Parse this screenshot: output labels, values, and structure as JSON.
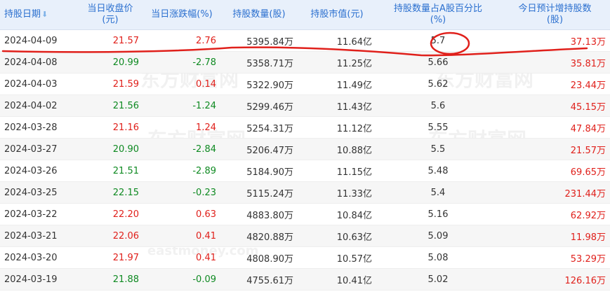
{
  "header": {
    "date": "持股日期",
    "close": "当日收盘价\n(元)",
    "change": "当日涨跌幅(%)",
    "qty": "持股数量(股)",
    "value": "持股市值(元)",
    "ratio": "持股数量占A股百分比\n(%)",
    "est": "今日预计增持股数\n(股)"
  },
  "icons": {
    "sort": "sort-down-arrow-icon"
  },
  "colors": {
    "up": "#e0201b",
    "down": "#0f8a22",
    "header_bg": "#e8f0fb",
    "header_text": "#2a6fcf",
    "annotation": "#e0201b"
  },
  "watermark": {
    "text": "东方财富网",
    "sub": "eastmoney.com"
  },
  "rows": [
    {
      "date": "2024-04-09",
      "close": "21.57",
      "change": "2.76",
      "qty": "5395.84万",
      "value": "11.64亿",
      "ratio": "5.7",
      "est": "37.13万",
      "dir": "up"
    },
    {
      "date": "2024-04-08",
      "close": "20.99",
      "change": "-2.78",
      "qty": "5358.71万",
      "value": "11.25亿",
      "ratio": "5.66",
      "est": "35.81万",
      "dir": "down"
    },
    {
      "date": "2024-04-03",
      "close": "21.59",
      "change": "0.14",
      "qty": "5322.90万",
      "value": "11.49亿",
      "ratio": "5.62",
      "est": "23.44万",
      "dir": "up"
    },
    {
      "date": "2024-04-02",
      "close": "21.56",
      "change": "-1.24",
      "qty": "5299.46万",
      "value": "11.43亿",
      "ratio": "5.6",
      "est": "45.15万",
      "dir": "down"
    },
    {
      "date": "2024-03-28",
      "close": "21.16",
      "change": "1.24",
      "qty": "5254.31万",
      "value": "11.12亿",
      "ratio": "5.55",
      "est": "47.84万",
      "dir": "up"
    },
    {
      "date": "2024-03-27",
      "close": "20.90",
      "change": "-2.84",
      "qty": "5206.47万",
      "value": "10.88亿",
      "ratio": "5.5",
      "est": "21.57万",
      "dir": "down"
    },
    {
      "date": "2024-03-26",
      "close": "21.51",
      "change": "-2.89",
      "qty": "5184.90万",
      "value": "11.15亿",
      "ratio": "5.48",
      "est": "69.65万",
      "dir": "down"
    },
    {
      "date": "2024-03-25",
      "close": "22.15",
      "change": "-0.23",
      "qty": "5115.24万",
      "value": "11.33亿",
      "ratio": "5.4",
      "est": "231.44万",
      "dir": "down"
    },
    {
      "date": "2024-03-22",
      "close": "22.20",
      "change": "0.63",
      "qty": "4883.80万",
      "value": "10.84亿",
      "ratio": "5.16",
      "est": "62.92万",
      "dir": "up"
    },
    {
      "date": "2024-03-21",
      "close": "22.06",
      "change": "0.41",
      "qty": "4820.88万",
      "value": "10.63亿",
      "ratio": "5.09",
      "est": "11.98万",
      "dir": "up"
    },
    {
      "date": "2024-03-20",
      "close": "21.97",
      "change": "0.41",
      "qty": "4808.90万",
      "value": "10.57亿",
      "ratio": "5.08",
      "est": "53.29万",
      "dir": "up"
    },
    {
      "date": "2024-03-19",
      "close": "21.88",
      "change": "-0.09",
      "qty": "4755.61万",
      "value": "10.41亿",
      "ratio": "5.02",
      "est": "126.16万",
      "dir": "down"
    }
  ]
}
